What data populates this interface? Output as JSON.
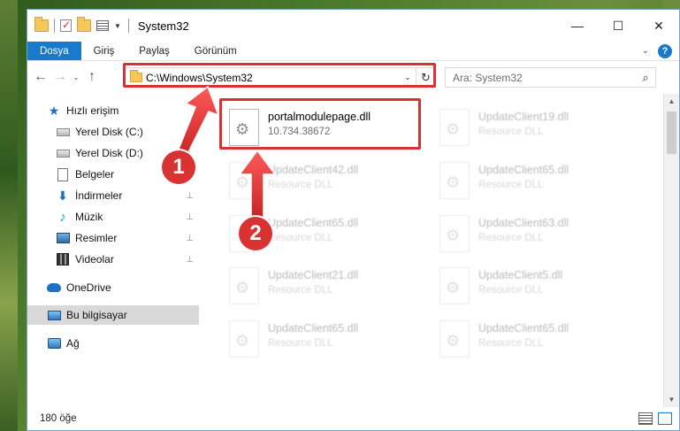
{
  "window": {
    "title": "System32",
    "controls": {
      "minimize": "—",
      "maximize": "☐",
      "close": "✕"
    }
  },
  "ribbon": {
    "tabs": [
      "Dosya",
      "Giriş",
      "Paylaş",
      "Görünüm"
    ],
    "help": "?"
  },
  "nav": {
    "back": "←",
    "forward": "→",
    "recent": "⌄",
    "up": "↑"
  },
  "address": {
    "path": "C:\\Windows\\System32",
    "dropdown": "⌄",
    "refresh": "↻"
  },
  "search": {
    "placeholder": "Ara: System32",
    "icon": "⌕"
  },
  "sidebar": {
    "items": [
      {
        "label": "Hızlı erişim",
        "icon": "star-icon"
      },
      {
        "label": "Yerel Disk (C:)",
        "icon": "drive-icon",
        "pinned": true
      },
      {
        "label": "Yerel Disk (D:)",
        "icon": "drive-icon",
        "pinned": true
      },
      {
        "label": "Belgeler",
        "icon": "document-icon",
        "pinned": true
      },
      {
        "label": "İndirmeler",
        "icon": "download-icon",
        "pinned": true
      },
      {
        "label": "Müzik",
        "icon": "music-icon",
        "pinned": true
      },
      {
        "label": "Resimler",
        "icon": "pictures-icon",
        "pinned": true
      },
      {
        "label": "Videolar",
        "icon": "video-icon",
        "pinned": true
      },
      {
        "label": "OneDrive",
        "icon": "cloud-icon"
      },
      {
        "label": "Bu bilgisayar",
        "icon": "pc-icon",
        "selected": true
      },
      {
        "label": "Ağ",
        "icon": "network-icon"
      }
    ],
    "pin_glyph": "📌"
  },
  "files": [
    {
      "name": "portalmodulepage.dll",
      "sub": "10.734.38672",
      "highlighted": true
    },
    {
      "name": "UpdateClient19.dll",
      "sub": "Resource DLL"
    },
    {
      "name": "UpdateClient42.dll",
      "sub": "Resource DLL"
    },
    {
      "name": "UpdateClient65.dll",
      "sub": "Resource DLL"
    },
    {
      "name": "UpdateClient65.dll",
      "sub": "Resource DLL"
    },
    {
      "name": "UpdateClient63.dll",
      "sub": "Resource DLL"
    },
    {
      "name": "UpdateClient21.dll",
      "sub": "Resource DLL"
    },
    {
      "name": "UpdateClient5.dll",
      "sub": "Resource DLL"
    },
    {
      "name": "UpdateClient65.dll",
      "sub": "Resource DLL"
    },
    {
      "name": "UpdateClient65.dll",
      "sub": "Resource DLL"
    }
  ],
  "callouts": [
    "1",
    "2"
  ],
  "status": {
    "count": "180 öğe"
  },
  "colors": {
    "accent": "#1979ca",
    "highlight": "#d93232",
    "selected": "#d9d9d9"
  }
}
